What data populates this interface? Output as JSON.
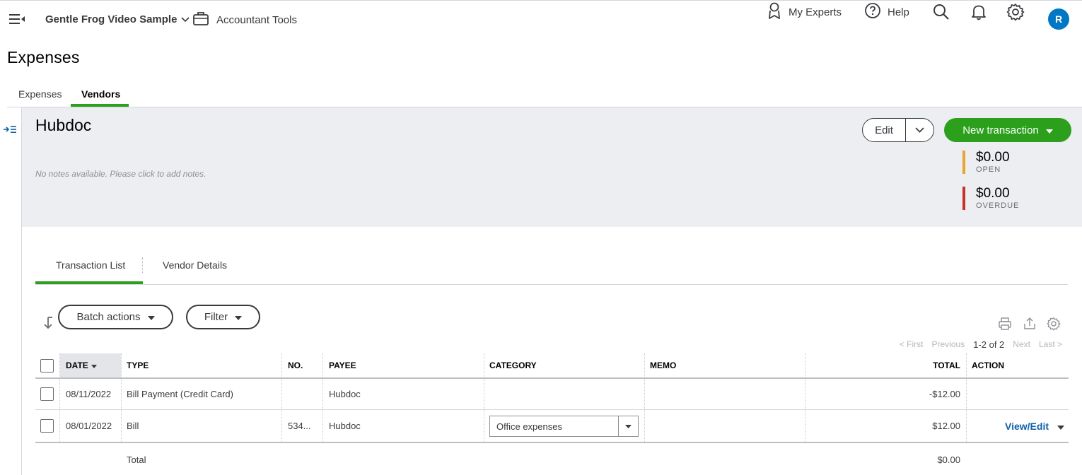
{
  "topbar": {
    "company_name": "Gentle Frog Video Sample",
    "accountant_tools": "Accountant Tools",
    "my_experts": "My Experts",
    "help": "Help",
    "avatar_initial": "R"
  },
  "page": {
    "title": "Expenses",
    "tabs": [
      {
        "label": "Expenses",
        "active": false
      },
      {
        "label": "Vendors",
        "active": true
      }
    ]
  },
  "vendor": {
    "name": "Hubdoc",
    "notes_placeholder": "No notes available. Please click to add notes.",
    "edit_label": "Edit",
    "new_transaction_label": "New transaction",
    "open": {
      "amount": "$0.00",
      "label": "OPEN",
      "color": "#e8a530"
    },
    "overdue": {
      "amount": "$0.00",
      "label": "OVERDUE",
      "color": "#c9302c"
    }
  },
  "subtabs": [
    {
      "label": "Transaction List",
      "active": true
    },
    {
      "label": "Vendor Details",
      "active": false
    }
  ],
  "toolbar": {
    "batch_actions": "Batch actions",
    "filter": "Filter"
  },
  "pager": {
    "first": "< First",
    "previous": "Previous",
    "range": "1-2 of 2",
    "next": "Next",
    "last": "Last >"
  },
  "table": {
    "headers": {
      "date": "DATE",
      "type": "TYPE",
      "no": "NO.",
      "payee": "PAYEE",
      "category": "CATEGORY",
      "memo": "MEMO",
      "total": "TOTAL",
      "action": "ACTION"
    },
    "rows": [
      {
        "date": "08/11/2022",
        "type": "Bill Payment (Credit Card)",
        "no": "",
        "payee": "Hubdoc",
        "category": "",
        "memo": "",
        "total": "-$12.00",
        "action": ""
      },
      {
        "date": "08/01/2022",
        "type": "Bill",
        "no": "534...",
        "payee": "Hubdoc",
        "category": "Office expenses",
        "memo": "",
        "total": "$12.00",
        "action": "View/Edit"
      }
    ],
    "total_row": {
      "label": "Total",
      "value": "$0.00"
    }
  },
  "colors": {
    "brand_green": "#2ca01c",
    "link_blue": "#0d62a8",
    "avatar_blue": "#0077c5"
  }
}
